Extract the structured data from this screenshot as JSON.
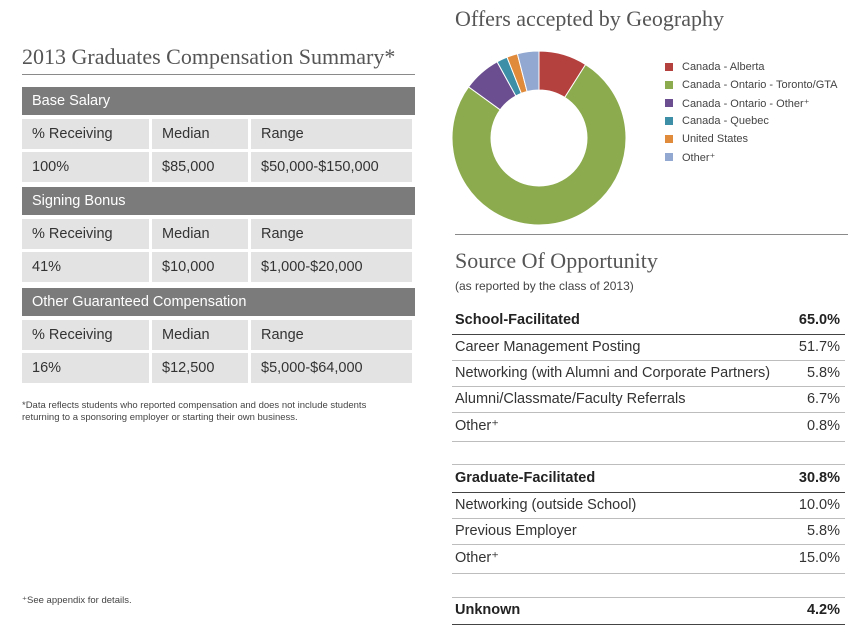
{
  "compensation": {
    "title": "2013 Graduates Compensation Summary*",
    "sections": [
      {
        "header": "Base Salary",
        "columns": [
          "% Receiving",
          "Median",
          "Range"
        ],
        "values": [
          "100%",
          "$85,000",
          "$50,000-$150,000"
        ]
      },
      {
        "header": "Signing Bonus",
        "columns": [
          "% Receiving",
          "Median",
          "Range"
        ],
        "values": [
          "41%",
          "$10,000",
          "$1,000-$20,000"
        ]
      },
      {
        "header": "Other Guaranteed Compensation",
        "columns": [
          "% Receiving",
          "Median",
          "Range"
        ],
        "values": [
          "16%",
          "$12,500",
          "$5,000-$64,000"
        ]
      }
    ],
    "note": "*Data reflects students who reported compensation and does not include students returning to a sponsoring employer or starting their own business.",
    "appendix_note": "⁺See appendix for details."
  },
  "geography": {
    "title": "Offers accepted by Geography",
    "legend": [
      {
        "label": "Canada - Alberta",
        "color": "#b5413f"
      },
      {
        "label": "Canada - Ontario - Toronto/GTA",
        "color": "#8bab4e"
      },
      {
        "label": "Canada - Ontario - Other⁺",
        "color": "#6b4e8f"
      },
      {
        "label": "Canada - Quebec",
        "color": "#3c8fa6"
      },
      {
        "label": "United States",
        "color": "#e08a3c"
      },
      {
        "label": "Other⁺",
        "color": "#93a8d0"
      }
    ]
  },
  "chart_data": {
    "type": "pie",
    "title": "Offers accepted by Geography",
    "categories": [
      "Canada - Alberta",
      "Canada - Ontario - Toronto/GTA",
      "Canada - Ontario - Other⁺",
      "Canada - Quebec",
      "United States",
      "Other⁺"
    ],
    "values": [
      9,
      76,
      7,
      2,
      2,
      4
    ],
    "colors": [
      "#b5413f",
      "#8bab4e",
      "#6b4e8f",
      "#3c8fa6",
      "#e08a3c",
      "#93a8d0"
    ],
    "legend": "right"
  },
  "source": {
    "title": "Source Of Opportunity",
    "subtitle": "(as reported by the class of 2013)",
    "groups": [
      {
        "label": "School-Facilitated",
        "value": "65.0%",
        "items": [
          {
            "label": "Career Management Posting",
            "value": "51.7%"
          },
          {
            "label": "Networking (with Alumni and Corporate Partners)",
            "value": "5.8%"
          },
          {
            "label": "Alumni/Classmate/Faculty Referrals",
            "value": "6.7%"
          },
          {
            "label": "Other⁺",
            "value": "0.8%"
          }
        ]
      },
      {
        "label": "Graduate-Facilitated",
        "value": "30.8%",
        "items": [
          {
            "label": "Networking (outside School)",
            "value": "10.0%"
          },
          {
            "label": "Previous Employer",
            "value": "5.8%"
          },
          {
            "label": "Other⁺",
            "value": "15.0%"
          }
        ]
      },
      {
        "label": "Unknown",
        "value": "4.2%",
        "items": []
      }
    ]
  }
}
